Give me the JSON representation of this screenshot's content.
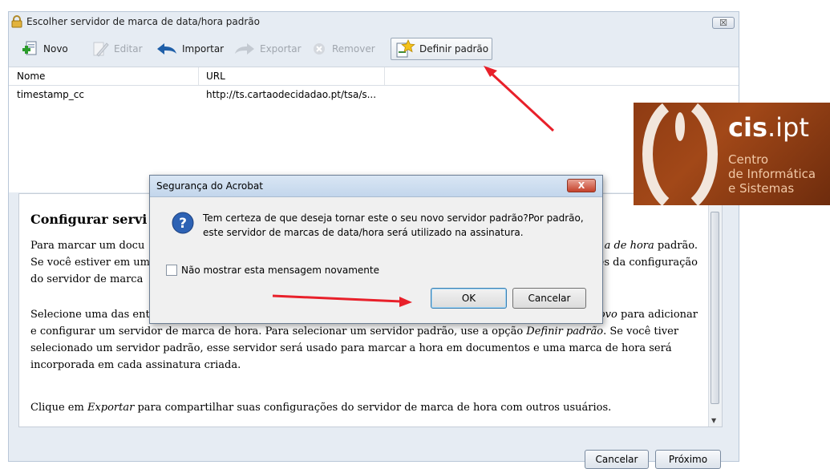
{
  "window": {
    "title": "Escolher servidor de marca de data/hora padrão",
    "close_label": "☒"
  },
  "toolbar": {
    "new_label": "Novo",
    "edit_label": "Editar",
    "import_label": "Importar",
    "export_label": "Exportar",
    "remove_label": "Remover",
    "set_default_label": "Definir padrão"
  },
  "list": {
    "columns": [
      "Nome",
      "URL"
    ],
    "rows": [
      {
        "name": "timestamp_cc",
        "url": "http://ts.cartaodecidadao.pt/tsa/s..."
      }
    ]
  },
  "description": {
    "heading": "Configurar servi",
    "p1_left": "Para marcar um docu",
    "p1_left2": "Se você estiver em um",
    "p1_left3": "do servidor de marca",
    "p1_right1_em": "a de hora",
    "p1_right1": " padrão.",
    "p1_right2": "es da configuração",
    "p2_left": "Selecione uma das ent",
    "p2_right_em": "Novo",
    "p2_right": " para adicionar",
    "p2_line2a": "e configurar um servidor de marca de hora. Para selecionar um servidor padrão, use a opção ",
    "p2_line2em": "Definir padrão",
    "p2_line2b": ". Se você tiver",
    "p2_line3": "selecionado um servidor padrão, esse servidor será usado para marcar a hora em documentos e uma marca de hora será",
    "p2_line4": "incorporada em cada assinatura criada.",
    "p3a": "Clique em ",
    "p3em": "Exportar",
    "p3b": " para compartilhar suas configurações do servidor de marca de hora com outros usuários."
  },
  "footer": {
    "cancel_label": "Cancelar",
    "next_label": "Próximo"
  },
  "dialog": {
    "title": "Segurança do Acrobat",
    "close_label": "X",
    "message": "Tem certeza de que deseja tornar este o seu novo servidor padrão?Por padrão, este servidor de marcas de data/hora será utilizado na assinatura.",
    "checkbox_label": "Não mostrar esta mensagem novamente",
    "ok_label": "OK",
    "cancel_label": "Cancelar"
  },
  "logo": {
    "brand_bold": "cis",
    "brand_rest": ".ipt",
    "line1": "Centro",
    "line2": "de Informática",
    "line3": "e Sistemas"
  },
  "colors": {
    "annotation_arrow": "#e8202a",
    "logo_background": "#9a4216"
  }
}
